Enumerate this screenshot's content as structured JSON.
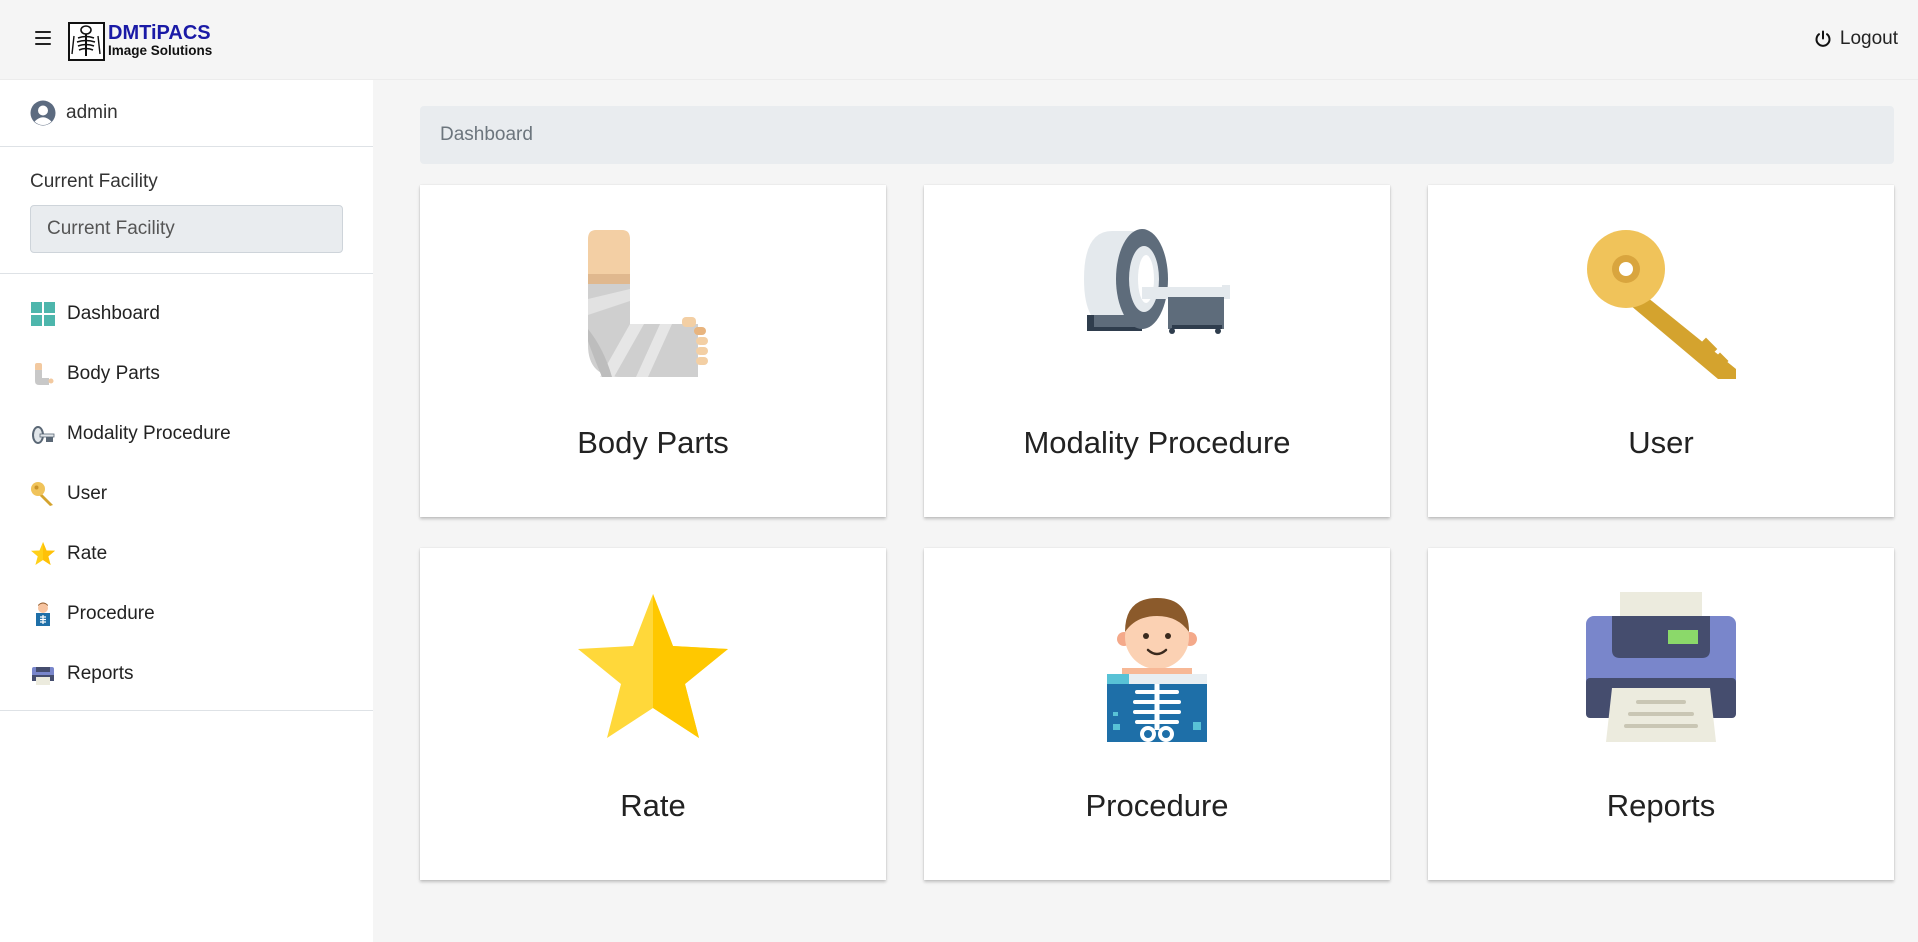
{
  "header": {
    "logo_line1": "DMTiPACS",
    "logo_line2": "Image Solutions",
    "logout_label": "Logout",
    "menu_icon": "hamburger-icon",
    "logout_icon": "power-icon"
  },
  "sidebar": {
    "username": "admin",
    "facility_label": "Current Facility",
    "facility_placeholder": "Current Facility",
    "items": [
      {
        "label": "Dashboard",
        "icon": "grid-icon"
      },
      {
        "label": "Body Parts",
        "icon": "arm-cast-icon"
      },
      {
        "label": "Modality Procedure",
        "icon": "mri-scanner-icon"
      },
      {
        "label": "User",
        "icon": "key-icon"
      },
      {
        "label": "Rate",
        "icon": "star-icon"
      },
      {
        "label": "Procedure",
        "icon": "xray-patient-icon"
      },
      {
        "label": "Reports",
        "icon": "printer-icon"
      }
    ]
  },
  "main": {
    "breadcrumb": "Dashboard",
    "cards": [
      {
        "label": "Body Parts",
        "icon": "arm-cast-icon"
      },
      {
        "label": "Modality Procedure",
        "icon": "mri-scanner-icon"
      },
      {
        "label": "User",
        "icon": "key-icon"
      },
      {
        "label": "Rate",
        "icon": "star-icon"
      },
      {
        "label": "Procedure",
        "icon": "xray-patient-icon"
      },
      {
        "label": "Reports",
        "icon": "printer-icon"
      }
    ]
  },
  "colors": {
    "logo_blue": "#1a1aa6",
    "dashboard_teal": "#4db6ac",
    "key_gold": "#f0c35a",
    "star_yellow": "#ffd018",
    "breadcrumb_bg": "#e9ecef"
  }
}
